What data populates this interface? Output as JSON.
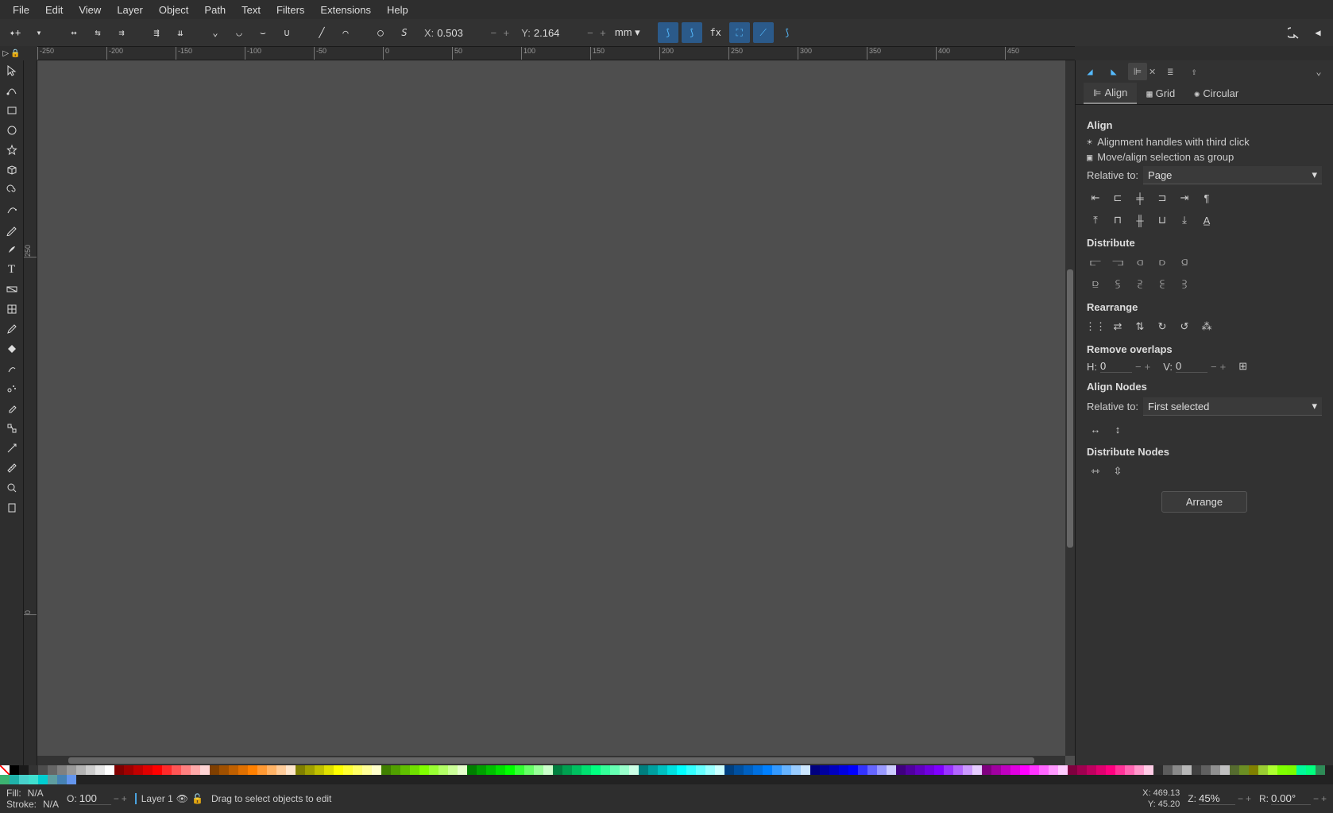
{
  "menu": [
    "File",
    "Edit",
    "View",
    "Layer",
    "Object",
    "Path",
    "Text",
    "Filters",
    "Extensions",
    "Help"
  ],
  "coords": {
    "x_label": "X:",
    "x": "0.503",
    "y_label": "Y:",
    "y": "2.164",
    "unit": "mm"
  },
  "ruler_h": [
    "-250",
    "-200",
    "-150",
    "-100",
    "-50",
    "0",
    "50",
    "100",
    "150",
    "200",
    "250",
    "300",
    "350",
    "400",
    "450"
  ],
  "ruler_v": [
    "250",
    "0"
  ],
  "panel": {
    "tabs": {
      "align": "Align",
      "grid": "Grid",
      "circular": "Circular"
    },
    "align": {
      "heading": "Align",
      "opt1": "Alignment handles with third click",
      "opt2": "Move/align selection as group",
      "relative_label": "Relative to:",
      "relative_value": "Page"
    },
    "distribute": "Distribute",
    "rearrange": "Rearrange",
    "remove_overlaps": "Remove overlaps",
    "overlap": {
      "h_label": "H:",
      "h": "0",
      "v_label": "V:",
      "v": "0"
    },
    "align_nodes": "Align Nodes",
    "nodes_relative_label": "Relative to:",
    "nodes_relative_value": "First selected",
    "distribute_nodes": "Distribute Nodes",
    "arrange": "Arrange"
  },
  "status": {
    "fill_label": "Fill:",
    "fill": "N/A",
    "stroke_label": "Stroke:",
    "stroke": "N/A",
    "opacity_label": "O:",
    "opacity": "100",
    "layer": "Layer 1",
    "msg": "Drag to select objects to edit",
    "x_label": "X:",
    "x": "469.13",
    "y_label": "Y:",
    "y": "45.20",
    "z_label": "Z:",
    "z": "45%",
    "r_label": "R:",
    "r": "0.00°"
  },
  "palette": [
    "none",
    "#000000",
    "#1a1a1a",
    "#333333",
    "#4d4d4d",
    "#666666",
    "#808080",
    "#999999",
    "#b3b3b3",
    "#cccccc",
    "#e6e6e6",
    "#ffffff",
    "#800000",
    "#a00000",
    "#c00000",
    "#e00000",
    "#ff0000",
    "#ff2a2a",
    "#ff5555",
    "#ff8080",
    "#ffaaaa",
    "#ffd5d5",
    "#7f3f00",
    "#a05000",
    "#c06000",
    "#e07000",
    "#ff8000",
    "#ff9933",
    "#ffb366",
    "#ffcc99",
    "#ffe6cc",
    "#807f00",
    "#a0a000",
    "#c0c000",
    "#e0e000",
    "#ffff00",
    "#ffff33",
    "#ffff66",
    "#ffff99",
    "#ffffcc",
    "#3f7f00",
    "#50a000",
    "#60c000",
    "#70e000",
    "#80ff00",
    "#99ff33",
    "#b3ff66",
    "#ccff99",
    "#e6ffcc",
    "#007f00",
    "#00a000",
    "#00c000",
    "#00e000",
    "#00ff00",
    "#33ff33",
    "#66ff66",
    "#99ff99",
    "#ccffcc",
    "#007f3f",
    "#00a050",
    "#00c060",
    "#00e070",
    "#00ff80",
    "#33ff99",
    "#66ffb3",
    "#99ffcc",
    "#ccffe6",
    "#007f7f",
    "#00a0a0",
    "#00c0c0",
    "#00e0e0",
    "#00ffff",
    "#33ffff",
    "#66ffff",
    "#99ffff",
    "#ccffff",
    "#003f7f",
    "#0050a0",
    "#0060c0",
    "#0070e0",
    "#0080ff",
    "#3399ff",
    "#66b3ff",
    "#99ccff",
    "#cce6ff",
    "#00007f",
    "#0000a0",
    "#0000c0",
    "#0000e0",
    "#0000ff",
    "#3333ff",
    "#6666ff",
    "#9999ff",
    "#ccccff",
    "#3f007f",
    "#5000a0",
    "#6000c0",
    "#7000e0",
    "#8000ff",
    "#9933ff",
    "#b366ff",
    "#cc99ff",
    "#e6ccff",
    "#7f007f",
    "#a000a0",
    "#c000c0",
    "#e000e0",
    "#ff00ff",
    "#ff33ff",
    "#ff66ff",
    "#ff99ff",
    "#ffccff",
    "#7f003f",
    "#a00050",
    "#c00060",
    "#e00070",
    "#ff0080",
    "#ff3399",
    "#ff66b3",
    "#ff99cc",
    "#ffcce6",
    "#2e2e2e",
    "#5c5c5c",
    "#8a8a8a",
    "#b8b8b8",
    "#404040",
    "#606060",
    "#909090",
    "#c0c0c0",
    "#556b2f",
    "#6b8e23",
    "#808000",
    "#9acd32",
    "#adff2f",
    "#7fff00",
    "#7cfc00",
    "#00fa9a",
    "#00ff7f",
    "#2e8b57",
    "#3cb371",
    "#20b2aa",
    "#48d1cc",
    "#40e0d0",
    "#00ced1",
    "#5f9ea0",
    "#4682b4",
    "#6495ed"
  ]
}
